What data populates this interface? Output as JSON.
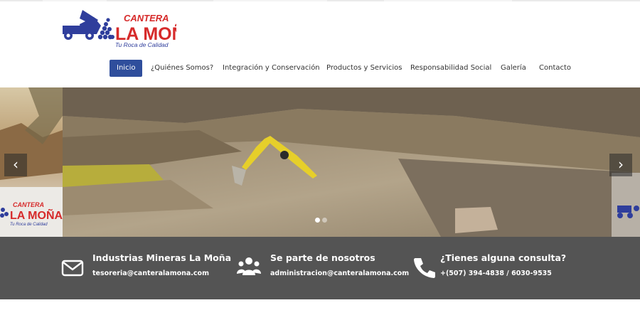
{
  "brand": {
    "name_top": "CANTERA",
    "name_main": "LA MOÑA",
    "tagline": "Tu Roca de Calidad",
    "colors": {
      "blue": "#2f3e9c",
      "red": "#d62a2a"
    }
  },
  "nav": {
    "items": [
      {
        "label": "Inicio",
        "active": true
      },
      {
        "label": "¿Quiénes Somos?",
        "active": false
      },
      {
        "label": "Integración y Conservación",
        "active": false
      },
      {
        "label": "Productos y Servicios",
        "active": false
      },
      {
        "label": "Responsabilidad Social",
        "active": false
      },
      {
        "label": "Galería",
        "active": false
      },
      {
        "label": "Contacto",
        "active": false
      }
    ],
    "active_color": "#2f4e9c"
  },
  "slider": {
    "prev_icon": "chevron-left-icon",
    "next_icon": "chevron-right-icon",
    "side_logo_top": "CANTERA",
    "side_logo_main": "LA MOÑA",
    "side_logo_tagline": "Tu Roca de Calidad",
    "slide_count": 2,
    "active_slide": 1
  },
  "contact": {
    "background": "#545454",
    "columns": [
      {
        "icon": "envelope-icon",
        "title": "Industrias Mineras La Moña",
        "detail": "tesoreria@canteralamona.com"
      },
      {
        "icon": "users-icon",
        "title": "Se parte de nosotros",
        "detail": "administracion@canteralamona.com"
      },
      {
        "icon": "phone-icon",
        "title": "¿Tienes alguna consulta?",
        "detail": "+(507) 394-4838 / 6030-9535"
      }
    ]
  }
}
